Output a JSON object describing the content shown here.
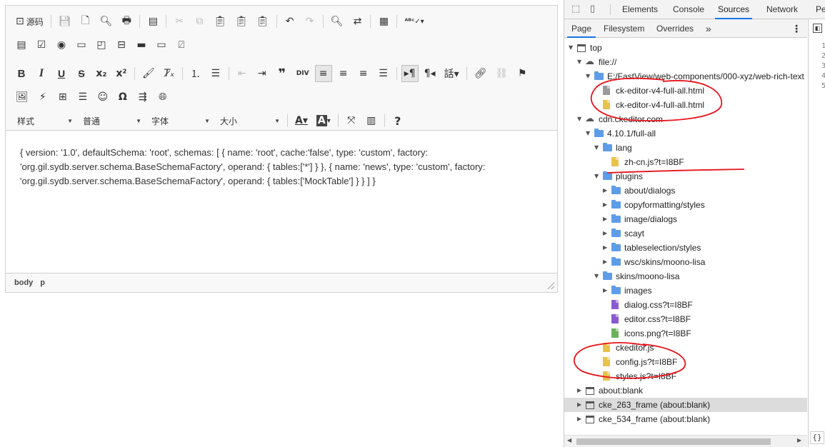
{
  "editor": {
    "toolbar": {
      "source_label": "源码",
      "format_combos": [
        {
          "label": "样式"
        },
        {
          "label": "普通"
        },
        {
          "label": "字体"
        },
        {
          "label": "大小"
        }
      ]
    },
    "content_text": "{ version: '1.0', defaultSchema: 'root', schemas: [ { name: 'root', cache:'false', type: 'custom', factory: 'org.gil.sydb.server.schema.BaseSchemaFactory', operand: { tables:['*'] } }, { name: 'news', type: 'custom', factory: 'org.gil.sydb.server.schema.BaseSchemaFactory', operand: { tables:['MockTable'] } } ] }",
    "statusbar": {
      "path": [
        "body",
        "p"
      ]
    }
  },
  "devtools": {
    "tabs": [
      "Elements",
      "Console",
      "Sources",
      "Network",
      "Pe"
    ],
    "active_tab": "Sources",
    "sub_tabs": [
      "Page",
      "Filesystem",
      "Overrides"
    ],
    "more_icon": "chevron-double-right-icon",
    "tree": [
      {
        "name": "top",
        "type": "frame",
        "depth": 0,
        "expanded": true
      },
      {
        "name": "file://",
        "type": "cloud",
        "depth": 1,
        "expanded": true
      },
      {
        "name": "E:/FastView/web-components/000-xyz/web-rich-text",
        "type": "folder",
        "depth": 2,
        "expanded": true
      },
      {
        "name": "ck-editor-v4-full-all.html",
        "type": "file-gray",
        "depth": 3
      },
      {
        "name": "ck-editor-v4-full-all.html",
        "type": "file-yellow",
        "depth": 3
      },
      {
        "name": "cdn.ckeditor.com",
        "type": "cloud",
        "depth": 1,
        "expanded": true
      },
      {
        "name": "4.10.1/full-all",
        "type": "folder",
        "depth": 2,
        "expanded": true
      },
      {
        "name": "lang",
        "type": "folder",
        "depth": 3,
        "expanded": true
      },
      {
        "name": "zh-cn.js?t=I8BF",
        "type": "file-yellow",
        "depth": 4
      },
      {
        "name": "plugins",
        "type": "folder",
        "depth": 3,
        "expanded": true
      },
      {
        "name": "about/dialogs",
        "type": "folder",
        "depth": 4,
        "expanded": false
      },
      {
        "name": "copyformatting/styles",
        "type": "folder",
        "depth": 4,
        "expanded": false
      },
      {
        "name": "image/dialogs",
        "type": "folder",
        "depth": 4,
        "expanded": false
      },
      {
        "name": "scayt",
        "type": "folder",
        "depth": 4,
        "expanded": false
      },
      {
        "name": "tableselection/styles",
        "type": "folder",
        "depth": 4,
        "expanded": false
      },
      {
        "name": "wsc/skins/moono-lisa",
        "type": "folder",
        "depth": 4,
        "expanded": false
      },
      {
        "name": "skins/moono-lisa",
        "type": "folder",
        "depth": 3,
        "expanded": true
      },
      {
        "name": "images",
        "type": "folder",
        "depth": 4,
        "expanded": false
      },
      {
        "name": "dialog.css?t=I8BF",
        "type": "file-purple",
        "depth": 4
      },
      {
        "name": "editor.css?t=I8BF",
        "type": "file-purple",
        "depth": 4
      },
      {
        "name": "icons.png?t=I8BF",
        "type": "file-green",
        "depth": 4
      },
      {
        "name": "ckeditor.js",
        "type": "file-yellow",
        "depth": 3
      },
      {
        "name": "config.js?t=I8BF",
        "type": "file-yellow",
        "depth": 3
      },
      {
        "name": "styles.js?t=I8BF",
        "type": "file-yellow",
        "depth": 3
      },
      {
        "name": "about:blank",
        "type": "frame",
        "depth": 1,
        "expanded": false
      },
      {
        "name": "cke_263_frame (about:blank)",
        "type": "frame",
        "depth": 1,
        "expanded": false,
        "selected": true
      },
      {
        "name": "cke_534_frame (about:blank)",
        "type": "frame",
        "depth": 1,
        "expanded": false
      }
    ],
    "line_numbers": [
      "1",
      "2",
      "3",
      "4",
      "5"
    ],
    "format_button": "{}"
  },
  "colors": {
    "accent": "#1a73e8",
    "annotation": "#e8141c",
    "folder": "#5e9ce8"
  }
}
